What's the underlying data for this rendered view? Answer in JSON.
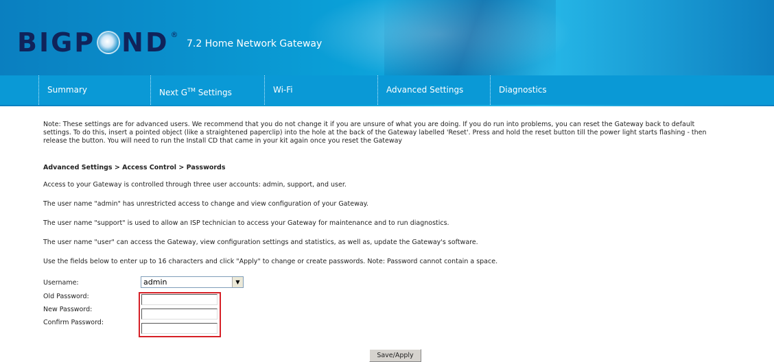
{
  "header": {
    "logo_text_left": "BIGP",
    "logo_text_right": "ND",
    "logo_registered": "®",
    "product_name": "7.2 Home Network Gateway"
  },
  "nav": {
    "items": [
      {
        "label": "Summary"
      },
      {
        "label": "Next G",
        "sup": "TM",
        "suffix": " Settings"
      },
      {
        "label": "Wi-Fi"
      },
      {
        "label": "Advanced Settings"
      },
      {
        "label": "Diagnostics"
      }
    ]
  },
  "content": {
    "note_line1": "Note: These settings are for advanced users. We recommend that you do not change it if you are unsure of what you are doing. If you do run into problems, you can reset the Gateway back to default",
    "note_line2": "settings. To do this, insert a pointed object (like a straightened paperclip) into the hole at the back of the Gateway labelled 'Reset'. Press and hold the reset button till the power light starts flashing - then",
    "note_line3": "release the button. You will need to run the Install CD that came in your kit again once you reset the Gateway",
    "breadcrumb": "Advanced Settings > Access Control > Passwords",
    "para1": "Access to your Gateway is controlled through three user accounts: admin, support, and user.",
    "para2": "The user name \"admin\" has unrestricted access to change and view configuration of your Gateway.",
    "para3": "The user name \"support\" is used to allow an ISP technician to access your Gateway for maintenance and to run diagnostics.",
    "para4": "The user name \"user\" can access the Gateway, view configuration settings and statistics, as well as, update the Gateway's software.",
    "para5": "Use the fields below to enter up to 16 characters and click \"Apply\" to change or create passwords. Note: Password cannot contain a space."
  },
  "form": {
    "username_label": "Username:",
    "username_value": "admin",
    "old_password_label": "Old Password:",
    "new_password_label": "New Password:",
    "confirm_password_label": "Confirm Password:",
    "old_password_value": "",
    "new_password_value": "",
    "confirm_password_value": "",
    "save_button": "Save/Apply"
  },
  "colors": {
    "header_blue": "#0a99d6",
    "highlight_red": "#d61f26",
    "logo_navy": "#10235a"
  }
}
